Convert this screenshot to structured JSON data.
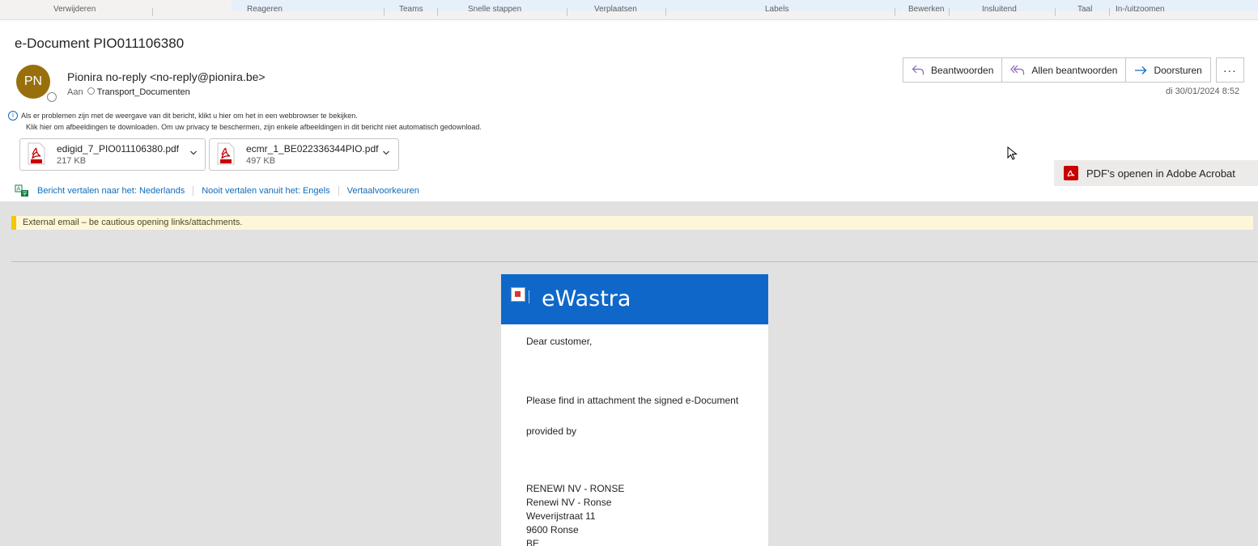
{
  "ribbon": {
    "items": [
      "Verwijderen",
      "Reageren",
      "Teams",
      "Snelle stappen",
      "Verplaatsen",
      "Labels",
      "Bewerken",
      "Insluitend",
      "Taal",
      "In-/uitzoomen"
    ]
  },
  "message": {
    "subject": "e-Document PIO011106380",
    "avatar_initials": "PN",
    "sender": "Pionira no-reply <no-reply@pionira.be>",
    "to_label": "Aan",
    "to_name": "Transport_Documenten",
    "date": "di 30/01/2024 8:52",
    "info_line1": "Als er problemen zijn met de weergave van dit bericht, klikt u hier om het in een webbrowser te bekijken.",
    "info_line2": "Klik hier om afbeeldingen te downloaden. Om uw privacy te beschermen, zijn enkele afbeeldingen in dit bericht niet automatisch gedownload."
  },
  "actions": {
    "reply": "Beantwoorden",
    "reply_all": "Allen beantwoorden",
    "forward": "Doorsturen",
    "more": "···"
  },
  "attachments": [
    {
      "name": "edigid_7_PIO011106380.pdf",
      "size": "217 KB"
    },
    {
      "name": "ecmr_1_BE022336344PIO.pdf",
      "size": "497 KB"
    }
  ],
  "acrobat_button": "PDF's openen in Adobe Acrobat",
  "translate": {
    "translate_to": "Bericht vertalen naar het: Nederlands",
    "never_translate": "Nooit vertalen vanuit het: Engels",
    "preferences": "Vertaalvoorkeuren"
  },
  "warning": "External email – be cautious opening links/attachments.",
  "email_body": {
    "brand": "eWastra",
    "greeting": "Dear customer,",
    "line1": "Please find in attachment the signed e-Document",
    "line2": "provided by",
    "address": [
      "RENEWI NV - RONSE",
      "Renewi NV - Ronse",
      "Weverijstraat 11",
      "9600 Ronse",
      "BE"
    ]
  },
  "colors": {
    "accent": "#0f6cbd",
    "header_blue": "#0f68c9",
    "avatar": "#986f0b",
    "warning_bar": "#f7c600",
    "pdf_red": "#c80000"
  }
}
